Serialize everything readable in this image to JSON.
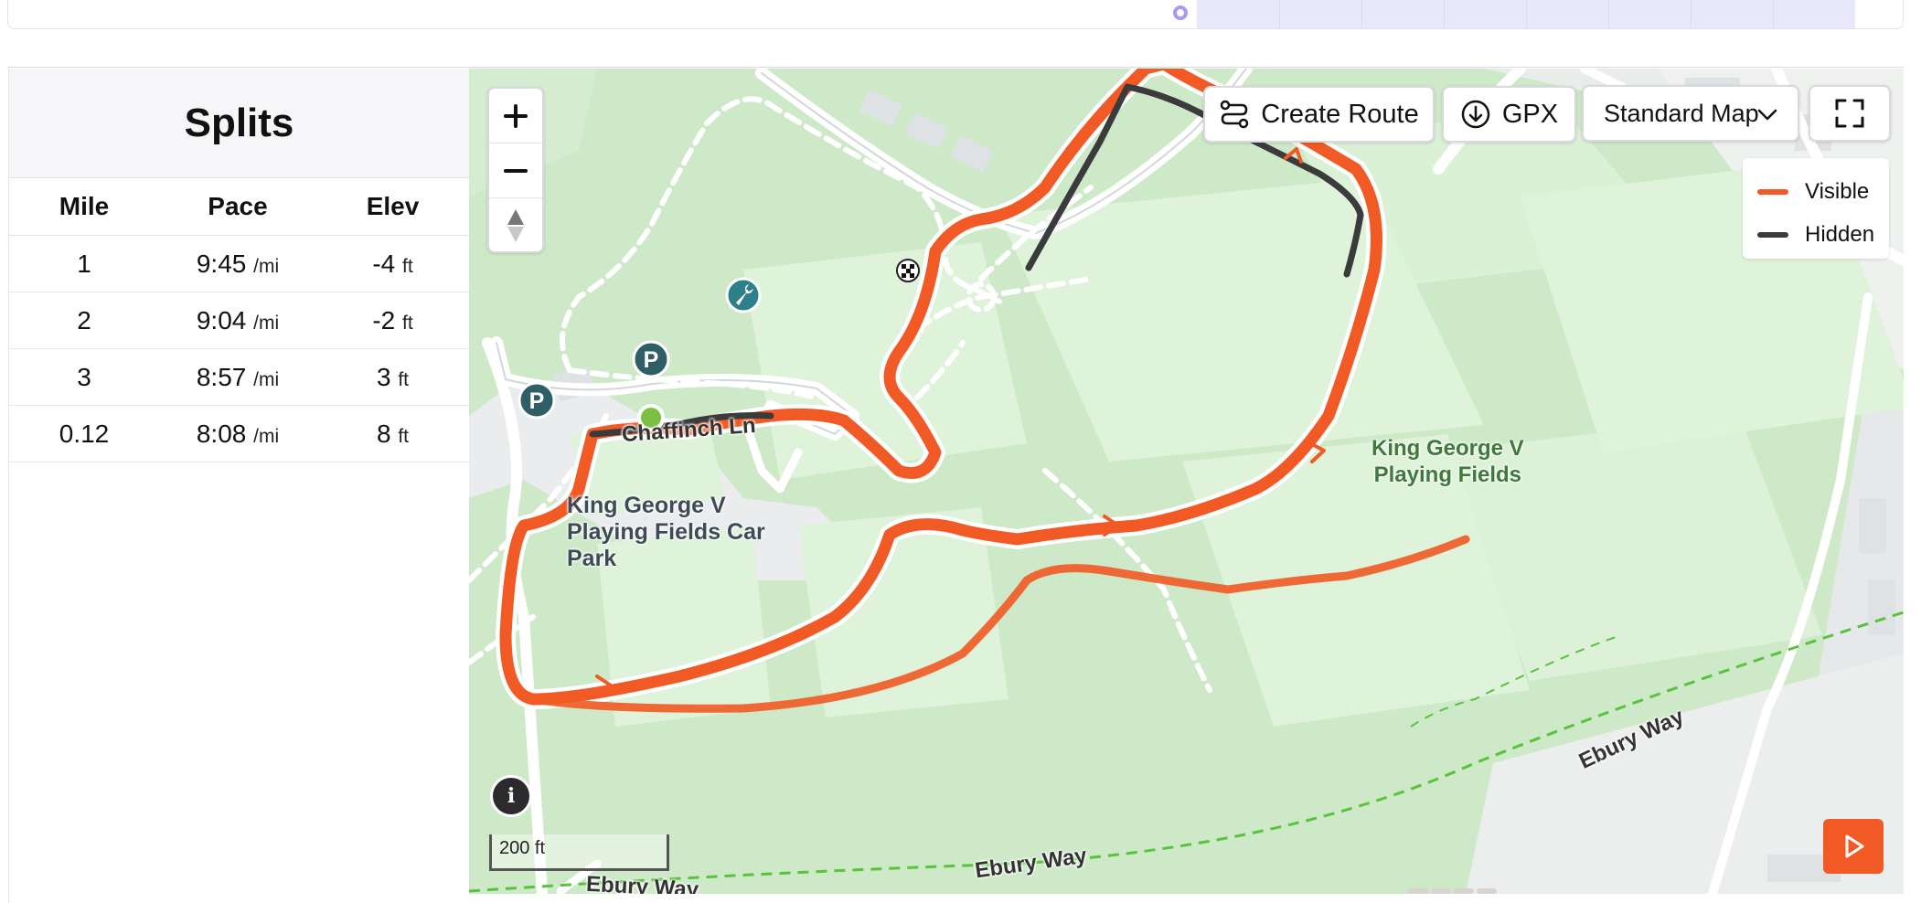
{
  "splits": {
    "title": "Splits",
    "columns": [
      "Mile",
      "Pace",
      "Elev"
    ],
    "rows": [
      {
        "mile": "1",
        "pace": "9:45",
        "pace_unit": "/mi",
        "elev": "-4",
        "elev_unit": "ft"
      },
      {
        "mile": "2",
        "pace": "9:04",
        "pace_unit": "/mi",
        "elev": "-2",
        "elev_unit": "ft"
      },
      {
        "mile": "3",
        "pace": "8:57",
        "pace_unit": "/mi",
        "elev": "3",
        "elev_unit": "ft"
      },
      {
        "mile": "0.12",
        "pace": "8:08",
        "pace_unit": "/mi",
        "elev": "8",
        "elev_unit": "ft"
      }
    ]
  },
  "map": {
    "toolbar": {
      "create_route": "Create Route",
      "gpx": "GPX",
      "map_style": "Standard Map"
    },
    "legend": {
      "visible": {
        "label": "Visible",
        "color": "#f15a24"
      },
      "hidden": {
        "label": "Hidden",
        "color": "#3b3b3b"
      }
    },
    "labels": {
      "road_chaffinch": "Chaffinch Ln",
      "car_park_line1": "King George V",
      "car_park_line2": "Playing Fields Car",
      "car_park_line3": "Park",
      "park_line1": "King George V",
      "park_line2": "Playing Fields",
      "ebury_right": "Ebury Way",
      "ebury_mid": "Ebury Way",
      "ebury_left": "Ebury Way"
    },
    "scale": "200 ft",
    "colors": {
      "route": "#f15a24",
      "hidden_route": "#3b3b3b",
      "park": "#cde9c7",
      "field": "#dff2da",
      "start_marker": "#7ac143",
      "play_button": "#f15a24"
    }
  }
}
